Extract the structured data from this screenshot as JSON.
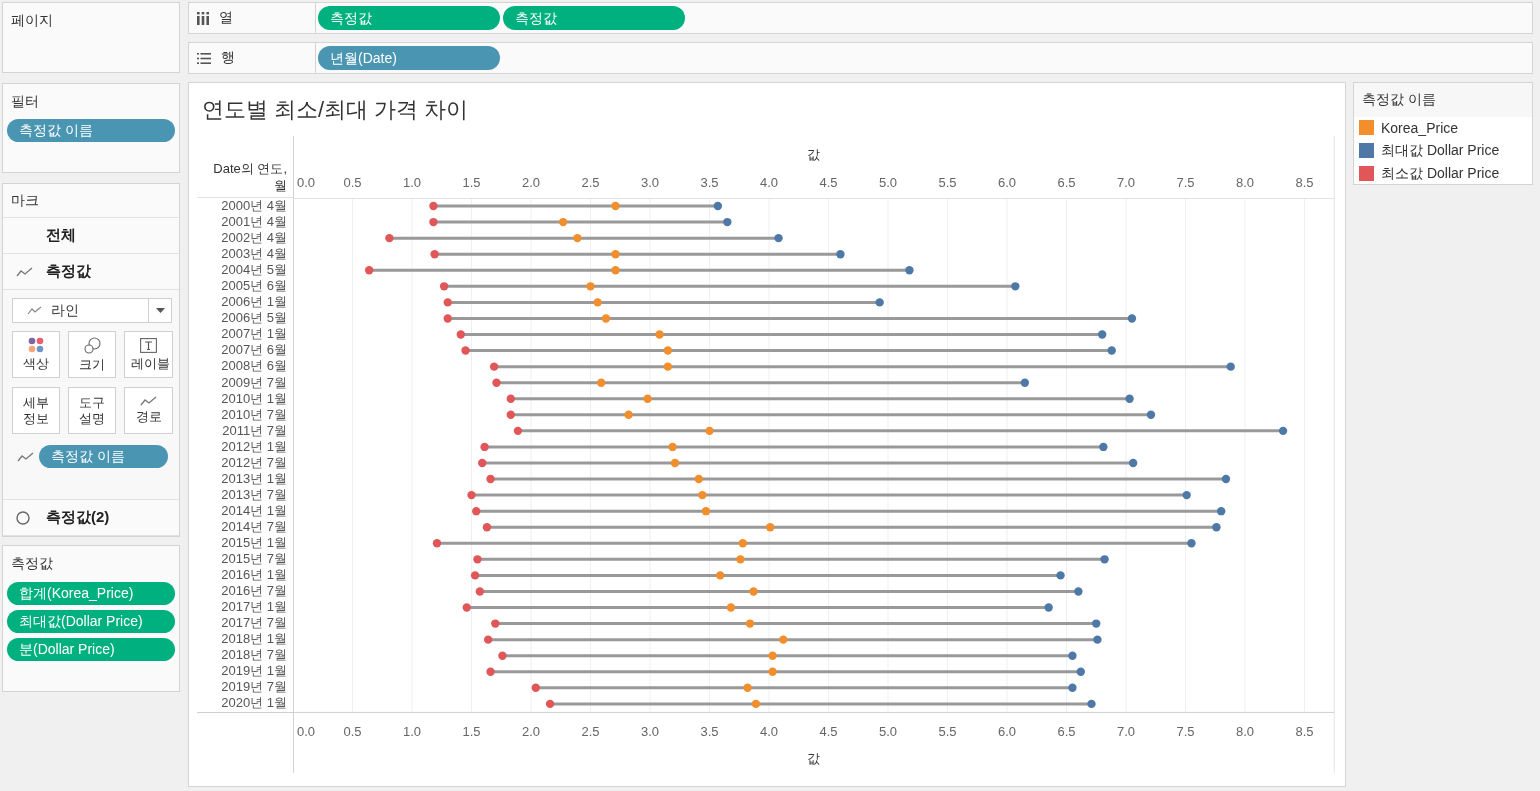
{
  "shelves": [
    {
      "label": "열",
      "kind": "columns",
      "pills": [
        {
          "label": "측정값",
          "kind": "measure"
        },
        {
          "label": "측정값",
          "kind": "measure"
        }
      ]
    },
    {
      "label": "행",
      "kind": "rows",
      "pills": [
        {
          "label": "년월(Date)",
          "kind": "dimension"
        }
      ]
    }
  ],
  "pages_card": {
    "title": "페이지"
  },
  "filters_card": {
    "title": "필터",
    "pills": [
      {
        "label": "측정값 이름",
        "kind": "dimension"
      }
    ]
  },
  "marks_card": {
    "title": "마크",
    "sections": [
      {
        "label": "전체",
        "kind": "all"
      },
      {
        "label": "측정값",
        "kind": "line",
        "mark_type": "라인",
        "buttons": [
          {
            "label": "색상",
            "kind": "color"
          },
          {
            "label": "크기",
            "kind": "size"
          },
          {
            "label": "레이블",
            "kind": "label"
          },
          {
            "label": "세부 정보",
            "kind": "detail"
          },
          {
            "label": "도구 설명",
            "kind": "tooltip"
          },
          {
            "label": "경로",
            "kind": "path"
          }
        ],
        "fields": [
          {
            "label": "측정값 이름",
            "kind": "dimension"
          }
        ]
      },
      {
        "label": "측정값(2)",
        "kind": "circle"
      }
    ]
  },
  "measure_values_card": {
    "title": "측정값",
    "pills": [
      {
        "label": "합계(Korea_Price)",
        "kind": "measure"
      },
      {
        "label": "최대값(Dollar Price)",
        "kind": "measure"
      },
      {
        "label": "분(Dollar Price)",
        "kind": "measure"
      }
    ]
  },
  "view": {
    "title": "연도별 최소/최대 가격 차이",
    "chart_data": [
      {
        "type": "scatter",
        "orientation": "horizontal",
        "grid": true,
        "legend": "right",
        "legend_title": "측정값 이름",
        "ylabel": "Date의 연도, 월",
        "x2label": "값",
        "xlabel": "값",
        "categories": [
          "2000년 4월",
          "2001년 4월",
          "2002년 4월",
          "2003년 4월",
          "2004년 5월",
          "2005년 6월",
          "2006년 1월",
          "2006년 5월",
          "2007년 1월",
          "2007년 6월",
          "2008년 6월",
          "2009년 7월",
          "2010년 1월",
          "2010년 7월",
          "2011년 7월",
          "2012년 1월",
          "2012년 7월",
          "2013년 1월",
          "2013년 7월",
          "2014년 1월",
          "2014년 7월",
          "2015년 1월",
          "2015년 7월",
          "2016년 1월",
          "2016년 7월",
          "2017년 1월",
          "2017년 7월",
          "2018년 1월",
          "2018년 7월",
          "2019년 1월",
          "2019년 7월",
          "2020년 1월"
        ],
        "series": [
          {
            "name": "Korea_Price",
            "color": "#f28e2b",
            "values": [
              2.71,
              2.27,
              2.39,
              2.71,
              2.71,
              2.5,
              2.56,
              2.63,
              3.08,
              3.15,
              3.15,
              2.59,
              2.98,
              2.82,
              3.5,
              3.19,
              3.21,
              3.41,
              3.44,
              3.47,
              4.01,
              3.78,
              3.76,
              3.59,
              3.87,
              3.68,
              3.84,
              4.12,
              4.03,
              4.03,
              3.82,
              3.89
            ]
          },
          {
            "name": "최대값 Dollar Price",
            "color": "#4e79a7",
            "values": [
              3.57,
              3.65,
              4.08,
              4.6,
              5.18,
              6.07,
              4.93,
              7.05,
              6.8,
              6.88,
              7.88,
              6.15,
              7.03,
              7.21,
              8.32,
              6.81,
              7.06,
              7.84,
              7.51,
              7.8,
              7.76,
              7.55,
              6.82,
              6.45,
              6.6,
              6.35,
              6.75,
              6.76,
              6.55,
              6.62,
              6.55,
              6.71
            ]
          },
          {
            "name": "최소값 Dollar Price",
            "color": "#e15759",
            "values": [
              1.18,
              1.18,
              0.81,
              1.19,
              0.64,
              1.27,
              1.3,
              1.3,
              1.41,
              1.45,
              1.69,
              1.71,
              1.83,
              1.83,
              1.89,
              1.61,
              1.59,
              1.66,
              1.5,
              1.54,
              1.63,
              1.21,
              1.55,
              1.53,
              1.57,
              1.46,
              1.7,
              1.64,
              1.76,
              1.66,
              2.04,
              2.16
            ]
          }
        ],
        "xlim": [
          0,
          8.75
        ],
        "x2lim": [
          0,
          8.75
        ],
        "x2ticks": [
          {
            "value": 0,
            "label": "0.0"
          },
          {
            "value": 0.5,
            "label": "0.5"
          },
          {
            "value": 1,
            "label": "1.0"
          },
          {
            "value": 1.5,
            "label": "1.5"
          },
          {
            "value": 2,
            "label": "2.0"
          },
          {
            "value": 2.5,
            "label": "2.5"
          },
          {
            "value": 3,
            "label": "3.0"
          },
          {
            "value": 3.5,
            "label": "3.5"
          },
          {
            "value": 4,
            "label": "4.0"
          },
          {
            "value": 4.5,
            "label": "4.5"
          },
          {
            "value": 5,
            "label": "5.0"
          },
          {
            "value": 5.5,
            "label": "5.5"
          },
          {
            "value": 6,
            "label": "6.0"
          },
          {
            "value": 6.5,
            "label": "6.5"
          },
          {
            "value": 7,
            "label": "7.0"
          },
          {
            "value": 7.5,
            "label": "7.5"
          },
          {
            "value": 8,
            "label": "8.0"
          },
          {
            "value": 8.5,
            "label": "8.5"
          }
        ],
        "xticks": [
          {
            "value": 0,
            "label": "0.0"
          },
          {
            "value": 0.5,
            "label": "0.5"
          },
          {
            "value": 1,
            "label": "1.0"
          },
          {
            "value": 1.5,
            "label": "1.5"
          },
          {
            "value": 2,
            "label": "2.0"
          },
          {
            "value": 2.5,
            "label": "2.5"
          },
          {
            "value": 3,
            "label": "3.0"
          },
          {
            "value": 3.5,
            "label": "3.5"
          },
          {
            "value": 4,
            "label": "4.0"
          },
          {
            "value": 4.5,
            "label": "4.5"
          },
          {
            "value": 5,
            "label": "5.0"
          },
          {
            "value": 5.5,
            "label": "5.5"
          },
          {
            "value": 6,
            "label": "6.0"
          },
          {
            "value": 6.5,
            "label": "6.5"
          },
          {
            "value": 7,
            "label": "7.0"
          },
          {
            "value": 7.5,
            "label": "7.5"
          },
          {
            "value": 8,
            "label": "8.0"
          },
          {
            "value": 8.5,
            "label": "8.5"
          }
        ]
      }
    ]
  }
}
